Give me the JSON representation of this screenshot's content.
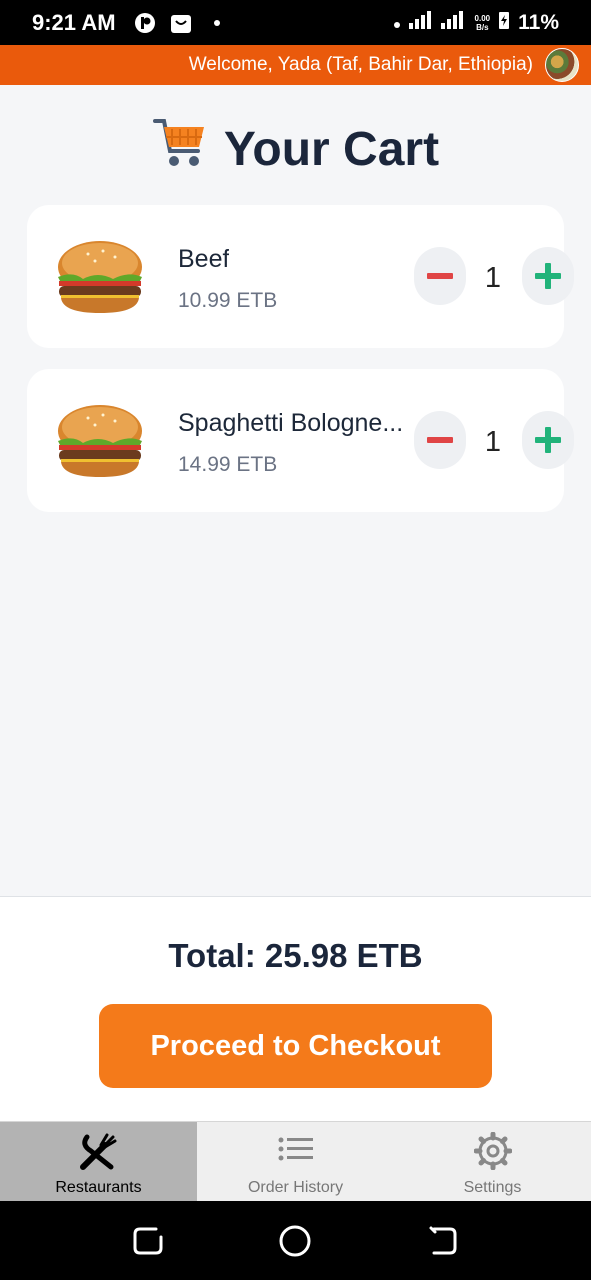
{
  "status_bar": {
    "time": "9:21 AM",
    "net_speed_value": "0.00",
    "net_speed_unit": "B/s",
    "battery": "11%"
  },
  "header": {
    "welcome": "Welcome, Yada (Taf, Bahir Dar, Ethiopia)"
  },
  "page": {
    "title": "Your Cart",
    "title_icon": "cart-icon"
  },
  "cart": {
    "items": [
      {
        "name": "Beef",
        "price": "10.99 ETB",
        "quantity": "1",
        "image": "burger-image"
      },
      {
        "name": "Spaghetti Bologne...",
        "price": "14.99 ETB",
        "quantity": "1",
        "image": "burger-image"
      }
    ]
  },
  "summary": {
    "total": "Total: 25.98 ETB",
    "checkout_label": "Proceed to Checkout"
  },
  "tabs": [
    {
      "label": "Restaurants",
      "icon": "fork-knife-icon",
      "active": true
    },
    {
      "label": "Order History",
      "icon": "list-icon",
      "active": false
    },
    {
      "label": "Settings",
      "icon": "gear-icon",
      "active": false
    }
  ],
  "colors": {
    "brand_orange": "#ea5a0c",
    "checkout_orange": "#f47a1a",
    "minus_red": "#e04545",
    "plus_green": "#21b37a"
  }
}
